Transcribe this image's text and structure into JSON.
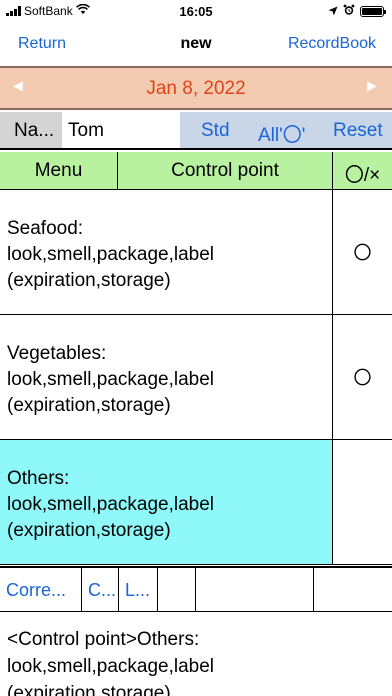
{
  "status_bar": {
    "carrier": "SoftBank",
    "time": "16:05",
    "icons": [
      "signal-bars-icon",
      "wifi-icon",
      "location-arrow-icon",
      "alarm-clock-icon",
      "battery-icon"
    ]
  },
  "nav": {
    "left_label": "Return",
    "title": "new",
    "right_label": "RecordBook"
  },
  "date_bar": {
    "prev_arrow": "◄",
    "date": "Jan 8, 2022",
    "next_arrow": "►"
  },
  "name_bar": {
    "label": "Na...",
    "value": "Tom",
    "std_label": "Std",
    "all_label": "All'〇'",
    "reset_label": "Reset"
  },
  "table": {
    "headers": [
      "Menu",
      "Control point",
      "〇/×"
    ],
    "rows": [
      {
        "line1": "Seafood:",
        "line2": "look,smell,package,label",
        "line3": "(expiration,storage)",
        "mark": "〇"
      },
      {
        "line1": "Vegetables:",
        "line2": "look,smell,package,label",
        "line3": "(expiration,storage)",
        "mark": "〇"
      },
      {
        "line1": "Others:",
        "line2": "look,smell,package,label",
        "line3": "(expiration,storage)",
        "mark": ""
      }
    ]
  },
  "tabs": [
    "Corre...",
    "C...",
    "L...",
    "",
    "",
    ""
  ],
  "detail": {
    "line1": "<Control point>Others:",
    "line2": "look,smell,package,label",
    "line3": "(expiration,storage)"
  },
  "colors": {
    "link_blue": "#1a64d6",
    "date_bar_bg": "#f3cbb0",
    "date_text": "#e0441b",
    "header_green": "#b8f2a0",
    "selected_cyan": "#8ff8f8"
  }
}
